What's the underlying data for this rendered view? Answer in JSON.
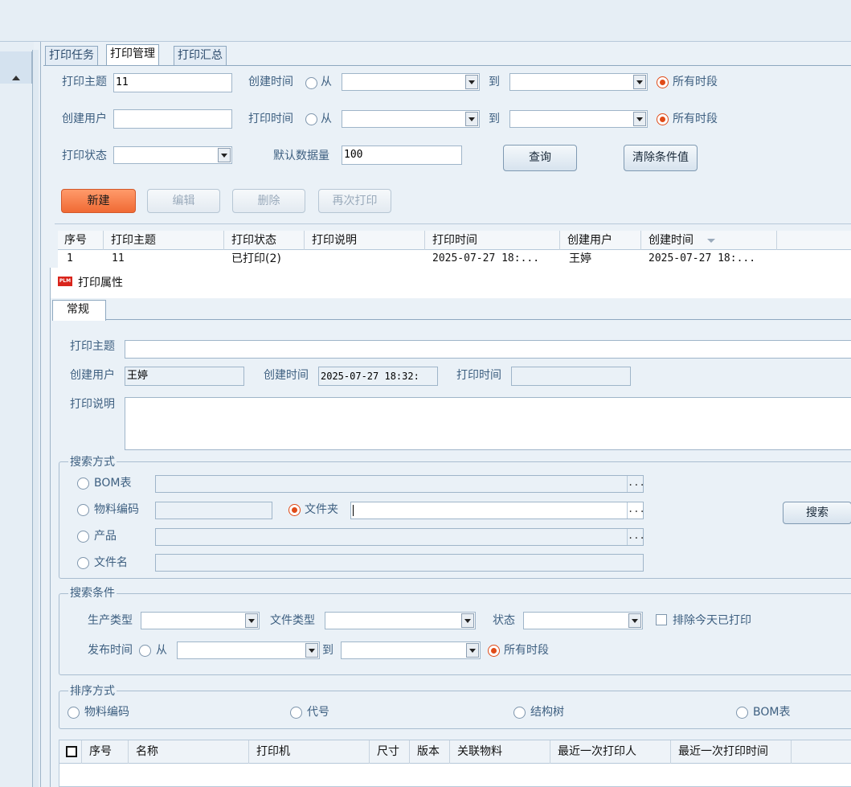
{
  "tabs": [
    "打印任务",
    "打印管理",
    "打印汇总"
  ],
  "filters": {
    "print_subject_label": "打印主题",
    "print_subject_value": "11",
    "create_time_label": "创建时间",
    "from_label": "从",
    "to_label": "到",
    "all_periods_label": "所有时段",
    "create_user_label": "创建用户",
    "print_time_label": "打印时间",
    "print_status_label": "打印状态",
    "default_count_label": "默认数据量",
    "default_count_value": "100",
    "query_button": "查询",
    "clear_button": "清除条件值"
  },
  "toolbar": {
    "new": "新建",
    "edit": "编辑",
    "delete": "删除",
    "reprint": "再次打印"
  },
  "main_table": {
    "headers": [
      "序号",
      "打印主题",
      "打印状态",
      "打印说明",
      "打印时间",
      "创建用户",
      "创建时间"
    ],
    "rows": [
      [
        "1",
        "11",
        "已打印(2)",
        "",
        "2025-07-27 18:...",
        "王婷",
        "2025-07-27 18:..."
      ]
    ]
  },
  "dialog": {
    "title": "打印属性",
    "tab": "常规",
    "subject_label": "打印主题",
    "subject_value": "",
    "create_user_label": "创建用户",
    "create_user_value": "王婷",
    "create_time_label": "创建时间",
    "create_time_value": "2025-07-27 18:32:",
    "print_time_label": "打印时间",
    "print_time_value": "",
    "desc_label": "打印说明",
    "search_mode": {
      "title": "搜索方式",
      "bom": "BOM表",
      "material_code": "物料编码",
      "folder": "文件夹",
      "product": "产品",
      "filename": "文件名",
      "search_button": "搜索",
      "ellipsis": "..."
    },
    "search_cond": {
      "title": "搜索条件",
      "production_type": "生产类型",
      "file_type": "文件类型",
      "status": "状态",
      "exclude_today": "排除今天已打印",
      "publish_time": "发布时间",
      "from": "从",
      "to": "到",
      "all_periods": "所有时段"
    },
    "sort_mode": {
      "title": "排序方式",
      "material_code": "物料编码",
      "code": "代号",
      "structure_tree": "结构树",
      "bom": "BOM表"
    },
    "table_headers": [
      "序号",
      "名称",
      "打印机",
      "尺寸",
      "版本",
      "关联物料",
      "最近一次打印人",
      "最近一次打印时间"
    ]
  }
}
